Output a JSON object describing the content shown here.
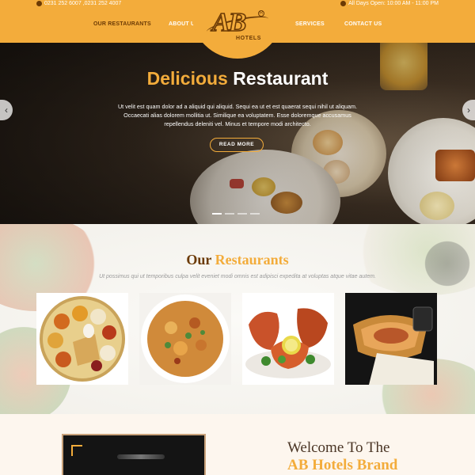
{
  "topbar": {
    "phone_icon": "phone-icon",
    "phone": "0231 252 6007 ,0231 252 4007",
    "clock_icon": "clock-icon",
    "hours": "All Days Open: 10:00 AM - 11:00 PM"
  },
  "nav": {
    "item1": "OUR RESTAURANTS",
    "item2": "ABOUT US",
    "item3": "SERVICES",
    "item4": "CONTACT US"
  },
  "logo": {
    "mark": "AB",
    "reg": "R",
    "text": "HOTELS"
  },
  "hero": {
    "title_part1": "Delicious",
    "title_part2": "Restaurant",
    "text": "Ut velit est quam dolor ad a aliquid qui aliquid. Sequi ea ut et est quaerat sequi nihil ut aliquam. Occaecati alias dolorem mollitia ut. Similique ea voluptatem. Esse doloremque accusamus repellendus deleniti vel. Minus et tempore modi architecto.",
    "button": "READ MORE",
    "prev_icon": "chevron-left-icon",
    "next_icon": "chevron-right-icon",
    "prev_glyph": "‹",
    "next_glyph": "›"
  },
  "restaurants": {
    "title_part1": "Our",
    "title_part2": "Restaurants",
    "subtitle": "Ut possimus qui ut temporibus culpa velit eveniet modi omnis est adipisci expedita at voluptas atque vitae autem."
  },
  "welcome": {
    "line1": "Welcome To The",
    "line2": "AB Hotels Brand"
  },
  "colors": {
    "accent": "#f3ac3b",
    "brown": "#6b3a05"
  }
}
